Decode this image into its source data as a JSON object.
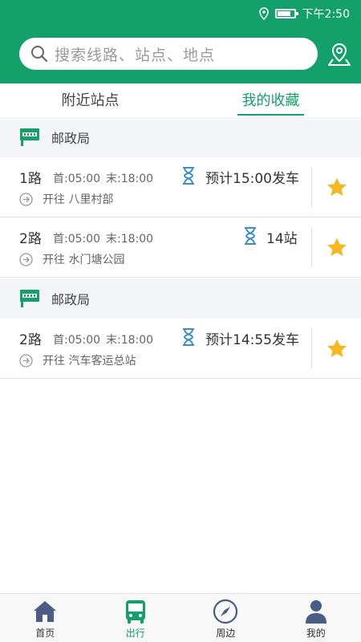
{
  "status": {
    "time": "下午2:50"
  },
  "search": {
    "placeholder": "搜索线路、站点、地点"
  },
  "tabs": [
    {
      "label": "附近站点"
    },
    {
      "label": "我的收藏"
    }
  ],
  "groups": [
    {
      "station": "邮政局",
      "routes": [
        {
          "route": "1路",
          "first": "首:05:00",
          "last": "末:18:00",
          "eta": "预计15:00发车",
          "direction": "开往 八里村部"
        },
        {
          "route": "2路",
          "first": "首:05:00",
          "last": "末:18:00",
          "eta": "14站",
          "direction": "开往 水门塘公园"
        }
      ]
    },
    {
      "station": "邮政局",
      "routes": [
        {
          "route": "2路",
          "first": "首:05:00",
          "last": "末:18:00",
          "eta": "预计14:55发车",
          "direction": "开往 汽车客运总站"
        }
      ]
    }
  ],
  "nav": [
    {
      "label": "首页",
      "icon": "home-icon"
    },
    {
      "label": "出行",
      "icon": "bus-icon"
    },
    {
      "label": "周边",
      "icon": "compass-icon"
    },
    {
      "label": "我的",
      "icon": "person-icon"
    }
  ],
  "colors": {
    "primary": "#13a06a",
    "star": "#f5b820",
    "hourglass": "#3b8fc6",
    "nav_icon": "#4a5d86"
  }
}
